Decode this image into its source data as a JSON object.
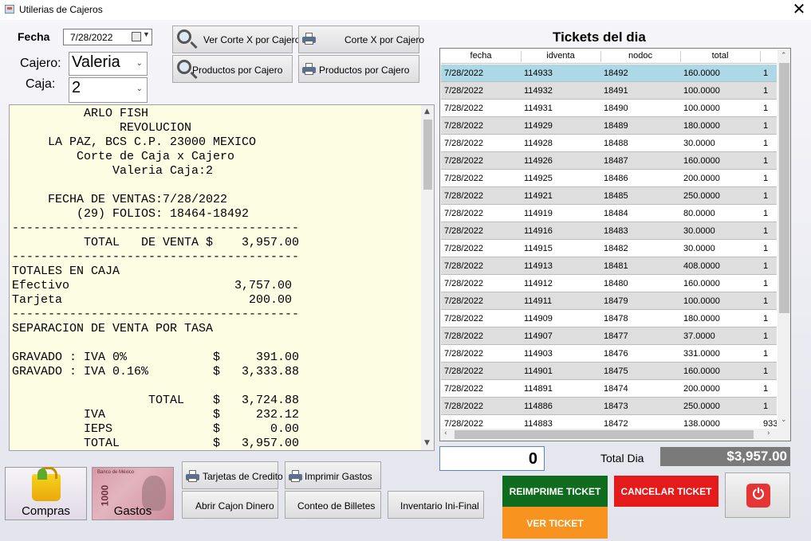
{
  "window": {
    "title": "Utilerias de Cajeros",
    "close_glyph": "✕"
  },
  "filters": {
    "fecha_label": "Fecha",
    "fecha_value": "7/28/2022",
    "cajero_label": "Cajero:",
    "cajero_value": "Valeria",
    "caja_label": "Caja:",
    "caja_value": "2"
  },
  "actions": {
    "ver_corte_x": "Ver Corte X por Cajero",
    "corte_x": "Corte X por Cajero",
    "productos_ver": "Productos por Cajero",
    "productos_print": "Productos por Cajero",
    "tarjetas": "Tarjetas de Credito",
    "imprimir_gastos": "Imprimir Gastos",
    "abrir_cajon": "Abrir Cajon Dinero",
    "conteo": "Conteo de Billetes",
    "inventario": "Inventario Ini-Final",
    "compras": "Compras",
    "gastos": "Gastos",
    "gastos_bill_number": "1000",
    "gastos_bill_bank": "Banco de México"
  },
  "receipt": {
    "lines": [
      "          ARLO FISH",
      "               REVOLUCION",
      "     LA PAZ, BCS C.P. 23000 MEXICO",
      "         Corte de Caja x Cajero",
      "              Valeria Caja:2",
      "",
      "     FECHA DE VENTAS:7/28/2022",
      "         (29) FOLIOS: 18464-18492",
      "----------------------------------------",
      "          TOTAL   DE VENTA $    3,957.00",
      "----------------------------------------",
      "TOTALES EN CAJA",
      "Efectivo                       3,757.00",
      "Tarjeta                          200.00",
      "----------------------------------------",
      "SEPARACION DE VENTA POR TASA",
      "",
      "GRAVADO : IVA 0%            $     391.00",
      "GRAVADO : IVA 0.16%         $   3,333.88",
      "",
      "                   TOTAL    $   3,724.88",
      "          IVA               $     232.12",
      "          IEPS              $       0.00",
      "          TOTAL             $   3,957.00"
    ]
  },
  "tickets": {
    "title": "Tickets del dia",
    "columns": [
      "fecha",
      "idventa",
      "nodoc",
      "total"
    ],
    "rows": [
      [
        "7/28/2022",
        "114933",
        "18492",
        "160.0000",
        "1"
      ],
      [
        "7/28/2022",
        "114932",
        "18491",
        "100.0000",
        "1"
      ],
      [
        "7/28/2022",
        "114931",
        "18490",
        "100.0000",
        "1"
      ],
      [
        "7/28/2022",
        "114929",
        "18489",
        "180.0000",
        "1"
      ],
      [
        "7/28/2022",
        "114928",
        "18488",
        "30.0000",
        "1"
      ],
      [
        "7/28/2022",
        "114926",
        "18487",
        "160.0000",
        "1"
      ],
      [
        "7/28/2022",
        "114925",
        "18486",
        "200.0000",
        "1"
      ],
      [
        "7/28/2022",
        "114921",
        "18485",
        "250.0000",
        "1"
      ],
      [
        "7/28/2022",
        "114919",
        "18484",
        "80.0000",
        "1"
      ],
      [
        "7/28/2022",
        "114916",
        "18483",
        "30.0000",
        "1"
      ],
      [
        "7/28/2022",
        "114915",
        "18482",
        "30.0000",
        "1"
      ],
      [
        "7/28/2022",
        "114913",
        "18481",
        "408.0000",
        "1"
      ],
      [
        "7/28/2022",
        "114912",
        "18480",
        "160.0000",
        "1"
      ],
      [
        "7/28/2022",
        "114911",
        "18479",
        "100.0000",
        "1"
      ],
      [
        "7/28/2022",
        "114909",
        "18478",
        "180.0000",
        "1"
      ],
      [
        "7/28/2022",
        "114907",
        "18477",
        "37.0000",
        "1"
      ],
      [
        "7/28/2022",
        "114903",
        "18476",
        "331.0000",
        "1"
      ],
      [
        "7/28/2022",
        "114901",
        "18475",
        "160.0000",
        "1"
      ],
      [
        "7/28/2022",
        "114891",
        "18474",
        "200.0000",
        "1"
      ],
      [
        "7/28/2022",
        "114886",
        "18473",
        "250.0000",
        "1"
      ],
      [
        "7/28/2022",
        "114883",
        "18472",
        "138.0000",
        "933"
      ]
    ],
    "selected_row": 0
  },
  "footer": {
    "input_value": "0",
    "total_dia_label": "Total Dia",
    "total_dia_value": "$3,957.00",
    "reimprime": "REIMPRIME TICKET",
    "cancelar": "CANCELAR TICKET",
    "ver_ticket": "VER TICKET",
    "colors": {
      "reimprime": "#0f6b1d",
      "cancelar": "#e51b1b",
      "ver_ticket": "#f7931e",
      "selected_row": "#add8e6"
    }
  }
}
